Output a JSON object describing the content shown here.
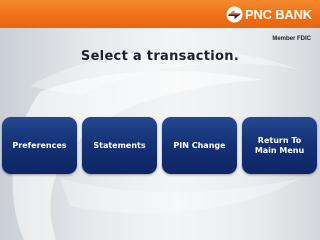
{
  "header": {
    "logo_text": "PNC BANK",
    "logo_icon": "pnc-logo-icon",
    "brand_color": "#ef6e16"
  },
  "member_fdic": "Member FDIC",
  "title": "Select a transaction.",
  "buttons": [
    {
      "label": "Preferences"
    },
    {
      "label": "Statements"
    },
    {
      "label": "PIN Change"
    },
    {
      "label": "Return To\nMain Menu"
    }
  ],
  "button_color": "#143277"
}
